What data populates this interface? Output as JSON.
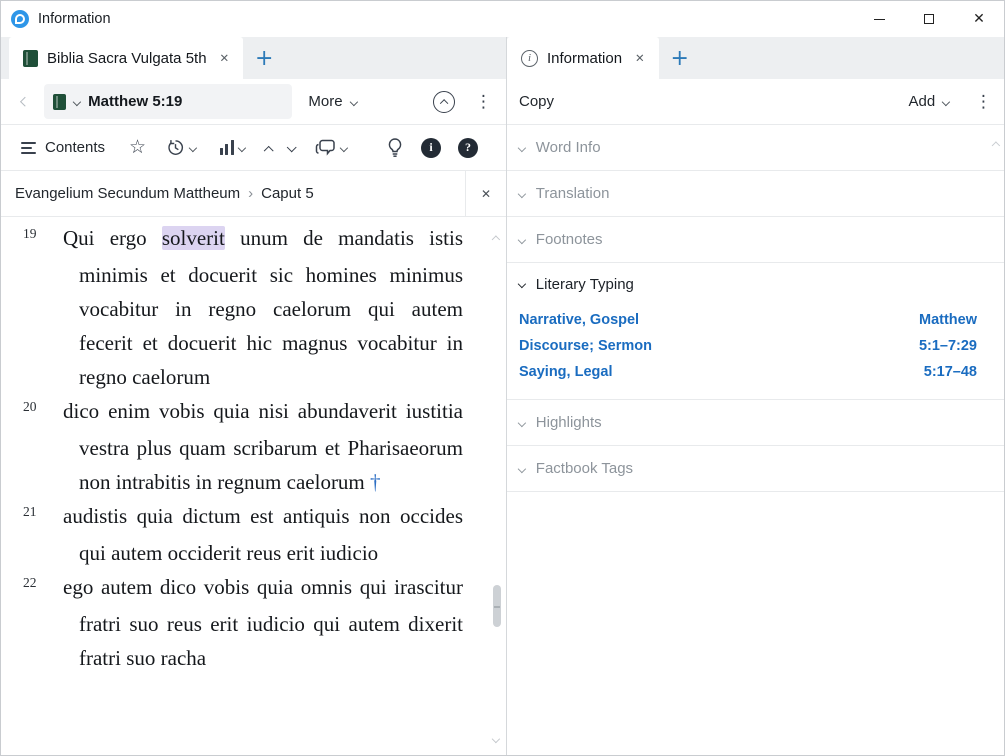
{
  "window": {
    "title": "Information"
  },
  "icons": {
    "star": "☆",
    "kebab": "⋮",
    "close": "✕",
    "plus": "+",
    "info_i": "i",
    "help_q": "?",
    "crumb_sep": "›"
  },
  "left_panel": {
    "tab": {
      "label": "Biblia Sacra Vulgata 5th"
    },
    "nav": {
      "reference": "Matthew 5:19",
      "more": "More"
    },
    "toolbar": {
      "contents": "Contents"
    },
    "breadcrumb": {
      "book": "Evangelium Secundum Mattheum",
      "chapter": "Caput 5"
    },
    "verses": [
      {
        "num": "19",
        "segments": [
          {
            "t": "Qui ergo "
          },
          {
            "t": "solverit",
            "style": "highlight"
          },
          {
            "t": " unum de mandatis istis minimis et docuerit sic homines minimus vocabitur in regno caelorum qui autem fecerit et docuerit hic magnus vocabitur in regno caelorum"
          }
        ]
      },
      {
        "num": "20",
        "segments": [
          {
            "t": "dico enim vobis quia nisi abundaverit iustitia vestra plus quam scribarum et Pharisaeorum non intrabitis in regnum caelorum "
          },
          {
            "t": "†",
            "style": "dagger"
          }
        ]
      },
      {
        "num": "21",
        "segments": [
          {
            "t": "audistis quia dictum est antiquis non occides qui autem occiderit reus erit iudicio"
          }
        ]
      },
      {
        "num": "22",
        "segments": [
          {
            "t": "ego autem dico vobis quia omnis qui irascitur fratri suo reus erit iudicio qui autem dixerit fratri suo racha"
          }
        ]
      }
    ]
  },
  "right_panel": {
    "tab": {
      "label": "Information"
    },
    "actions": {
      "copy": "Copy",
      "add": "Add"
    },
    "sections": [
      {
        "label": "Word Info",
        "expanded": false
      },
      {
        "label": "Translation",
        "expanded": false
      },
      {
        "label": "Footnotes",
        "expanded": false
      },
      {
        "label": "Literary Typing",
        "expanded": true,
        "rows": [
          {
            "left": "Narrative, Gospel",
            "right": "Matthew"
          },
          {
            "left": "Discourse; Sermon",
            "right": "5:1–7:29"
          },
          {
            "left": "Saying, Legal",
            "right": "5:17–48"
          }
        ]
      },
      {
        "label": "Highlights",
        "expanded": false
      },
      {
        "label": "Factbook Tags",
        "expanded": false
      }
    ]
  },
  "colors": {
    "accent_blue": "#1a6cc0",
    "highlight_purple": "#dcd4f1",
    "resource_green": "#1f4f38",
    "app_blue": "#2e96e8",
    "tabstrip_gray": "#edeff1"
  }
}
